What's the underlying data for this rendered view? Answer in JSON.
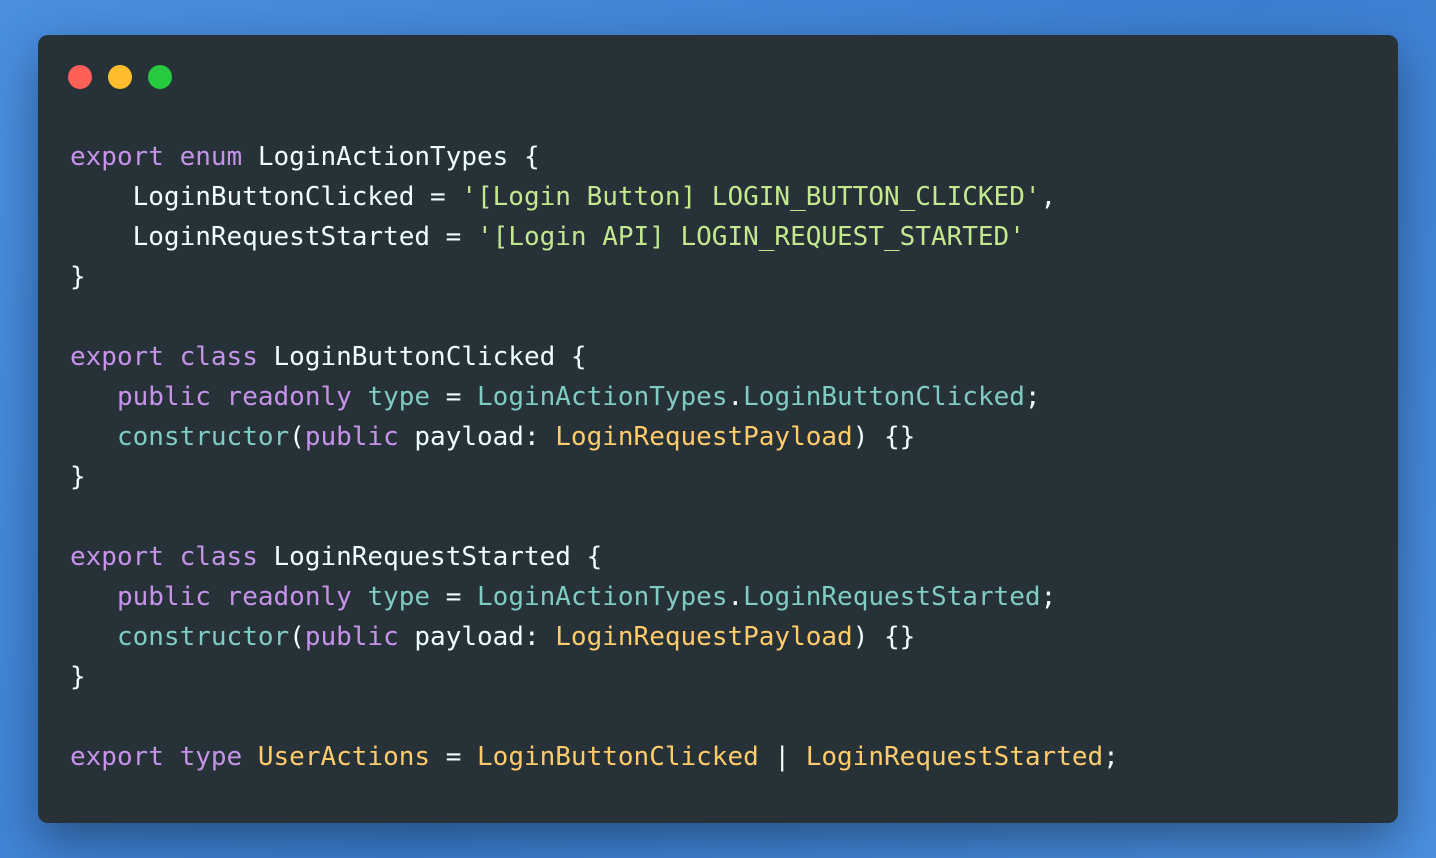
{
  "window": {
    "controls": [
      {
        "name": "close-button",
        "color": "#ff5f56"
      },
      {
        "name": "minimize-button",
        "color": "#ffbd2e"
      },
      {
        "name": "maximize-button",
        "color": "#27c93f"
      }
    ]
  },
  "code": {
    "language": "typescript",
    "lines": [
      [
        {
          "t": "export",
          "c": "keyword"
        },
        {
          "t": " ",
          "c": "plain"
        },
        {
          "t": "enum",
          "c": "keyword"
        },
        {
          "t": " LoginActionTypes {",
          "c": "plain"
        }
      ],
      [
        {
          "t": "    LoginButtonClicked = ",
          "c": "plain"
        },
        {
          "t": "'[Login Button] LOGIN_BUTTON_CLICKED'",
          "c": "string"
        },
        {
          "t": ",",
          "c": "plain"
        }
      ],
      [
        {
          "t": "    LoginRequestStarted = ",
          "c": "plain"
        },
        {
          "t": "'[Login API] LOGIN_REQUEST_STARTED'",
          "c": "string"
        }
      ],
      [
        {
          "t": "}",
          "c": "plain"
        }
      ],
      [],
      [
        {
          "t": "export",
          "c": "keyword"
        },
        {
          "t": " ",
          "c": "plain"
        },
        {
          "t": "class",
          "c": "keyword"
        },
        {
          "t": " LoginButtonClicked {",
          "c": "plain"
        }
      ],
      [
        {
          "t": "   ",
          "c": "plain"
        },
        {
          "t": "public",
          "c": "keyword"
        },
        {
          "t": " ",
          "c": "plain"
        },
        {
          "t": "readonly",
          "c": "keyword"
        },
        {
          "t": " ",
          "c": "plain"
        },
        {
          "t": "type",
          "c": "prop"
        },
        {
          "t": " = ",
          "c": "plain"
        },
        {
          "t": "LoginActionTypes",
          "c": "prop"
        },
        {
          "t": ".",
          "c": "plain"
        },
        {
          "t": "LoginButtonClicked",
          "c": "prop"
        },
        {
          "t": ";",
          "c": "plain"
        }
      ],
      [
        {
          "t": "   ",
          "c": "plain"
        },
        {
          "t": "constructor",
          "c": "prop"
        },
        {
          "t": "(",
          "c": "plain"
        },
        {
          "t": "public",
          "c": "keyword"
        },
        {
          "t": " payload: ",
          "c": "plain"
        },
        {
          "t": "LoginRequestPayload",
          "c": "type"
        },
        {
          "t": ") {}",
          "c": "plain"
        }
      ],
      [
        {
          "t": "}",
          "c": "plain"
        }
      ],
      [],
      [
        {
          "t": "export",
          "c": "keyword"
        },
        {
          "t": " ",
          "c": "plain"
        },
        {
          "t": "class",
          "c": "keyword"
        },
        {
          "t": " LoginRequestStarted {",
          "c": "plain"
        }
      ],
      [
        {
          "t": "   ",
          "c": "plain"
        },
        {
          "t": "public",
          "c": "keyword"
        },
        {
          "t": " ",
          "c": "plain"
        },
        {
          "t": "readonly",
          "c": "keyword"
        },
        {
          "t": " ",
          "c": "plain"
        },
        {
          "t": "type",
          "c": "prop"
        },
        {
          "t": " = ",
          "c": "plain"
        },
        {
          "t": "LoginActionTypes",
          "c": "prop"
        },
        {
          "t": ".",
          "c": "plain"
        },
        {
          "t": "LoginRequestStarted",
          "c": "prop"
        },
        {
          "t": ";",
          "c": "plain"
        }
      ],
      [
        {
          "t": "   ",
          "c": "plain"
        },
        {
          "t": "constructor",
          "c": "prop"
        },
        {
          "t": "(",
          "c": "plain"
        },
        {
          "t": "public",
          "c": "keyword"
        },
        {
          "t": " payload: ",
          "c": "plain"
        },
        {
          "t": "LoginRequestPayload",
          "c": "type"
        },
        {
          "t": ") {}",
          "c": "plain"
        }
      ],
      [
        {
          "t": "}",
          "c": "plain"
        }
      ],
      [],
      [
        {
          "t": "export",
          "c": "keyword"
        },
        {
          "t": " ",
          "c": "plain"
        },
        {
          "t": "type",
          "c": "keyword"
        },
        {
          "t": " ",
          "c": "plain"
        },
        {
          "t": "UserActions",
          "c": "type"
        },
        {
          "t": " = ",
          "c": "plain"
        },
        {
          "t": "LoginButtonClicked",
          "c": "type"
        },
        {
          "t": " | ",
          "c": "plain"
        },
        {
          "t": "LoginRequestStarted",
          "c": "type"
        },
        {
          "t": ";",
          "c": "plain"
        }
      ]
    ]
  },
  "colors": {
    "background_gradient": "#3c7fd2",
    "editor_background": "#263238",
    "keyword": "#c792ea",
    "type": "#ffcb6b",
    "string": "#c3e88d",
    "property": "#80cbc4",
    "plain": "#eeffff"
  }
}
